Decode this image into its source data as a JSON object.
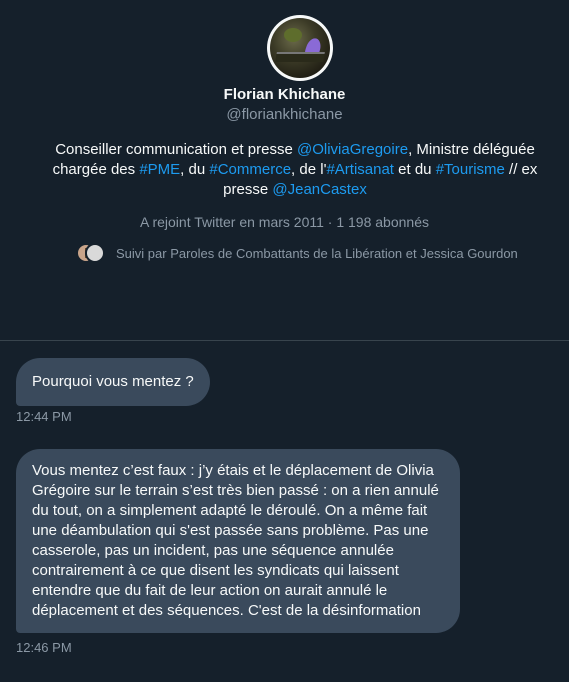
{
  "profile": {
    "name": "Florian Khichane",
    "handle": "@floriankhichane",
    "bio": {
      "p1": "Conseiller communication et presse ",
      "mention1": "@OliviaGregoire",
      "p2": ", Ministre déléguée chargée des ",
      "tag1": "#PME",
      "p3": ", du ",
      "tag2": "#Commerce",
      "p4": ", de l'",
      "tag3": "#Artisanat",
      "p5": " et du ",
      "tag4": "#Tourisme",
      "p6": " // ex presse ",
      "mention2": "@JeanCastex"
    },
    "joined": "A rejoint Twitter en mars 2011 · 1 198 abonnés",
    "followed_by": "Suivi par Paroles de Combattants de la Libération et Jessica Gourdon"
  },
  "messages": [
    {
      "text": "Pourquoi vous mentez ?",
      "time": "12:44 PM"
    },
    {
      "text": "Vous mentez c’est faux : j’y étais et le déplacement de Olivia Grégoire sur le terrain s’est très bien passé : on a rien annulé du tout, on a simplement adapté le déroulé. On a même fait une déambulation qui s'est passée sans problème. Pas une casserole, pas un incident, pas une séquence annulée contrairement à ce que disent les syndicats qui laissent entendre que du fait de leur action on aurait annulé le déplacement et des séquences. C'est de la désinformation",
      "time": "12:46 PM"
    }
  ],
  "colors": {
    "background": "#15202b",
    "bubble": "#3a4a5c",
    "link": "#1d9bf0",
    "muted": "#8b98a5"
  }
}
